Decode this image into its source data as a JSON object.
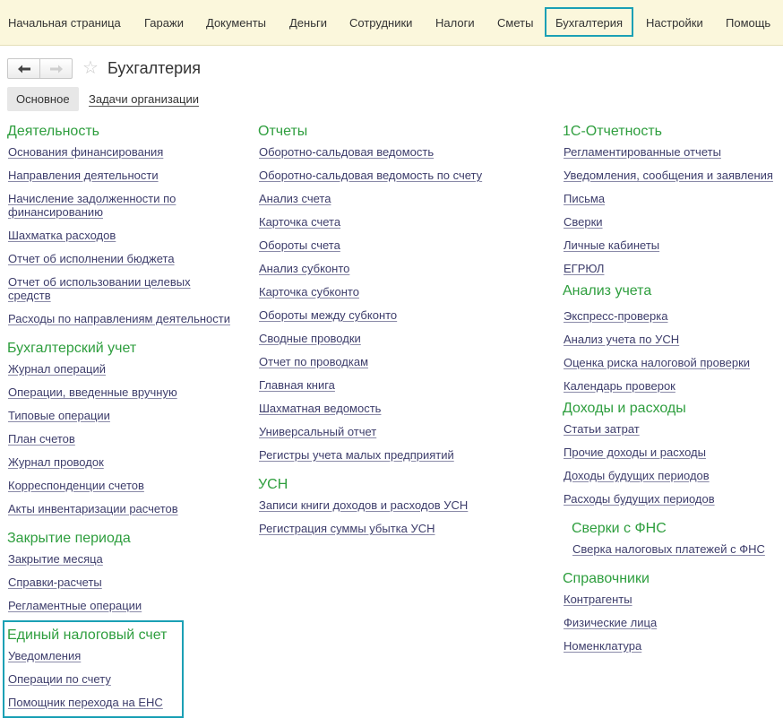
{
  "nav": [
    "Начальная страница",
    "Гаражи",
    "Документы",
    "Деньги",
    "Сотрудники",
    "Налоги",
    "Сметы",
    "Бухгалтерия",
    "Настройки",
    "Помощь"
  ],
  "page": {
    "title": "Бухгалтерия",
    "back_icon": "arrow-left-icon",
    "forward_icon": "arrow-right-icon",
    "favorite_icon": "star-icon"
  },
  "tabs": {
    "main": "Основное",
    "link": "Задачи организации"
  },
  "col1": {
    "s1": {
      "title": "Деятельность",
      "items": [
        "Основания финансирования",
        "Направления деятельности",
        "Начисление задолженности по финансированию",
        "Шахматка расходов",
        "Отчет об исполнении бюджета",
        "Отчет об использовании целевых средств",
        "Расходы по направлениям деятельности"
      ]
    },
    "s2": {
      "title": "Бухгалтерский учет",
      "items": [
        "Журнал операций",
        "Операции, введенные вручную",
        "Типовые операции",
        "План счетов",
        "Журнал проводок",
        "Корреспонденции счетов",
        "Акты инвентаризации расчетов"
      ]
    },
    "s3": {
      "title": "Закрытие периода",
      "items": [
        "Закрытие месяца",
        "Справки-расчеты",
        "Регламентные операции"
      ]
    },
    "s4": {
      "title": "Единый налоговый счет",
      "items": [
        "Уведомления",
        "Операции по счету",
        "Помощник перехода на ЕНС"
      ]
    }
  },
  "col2": {
    "s1": {
      "title": "Отчеты",
      "items": [
        "Оборотно-сальдовая ведомость",
        "Оборотно-сальдовая ведомость по счету",
        "Анализ счета",
        "Карточка счета",
        "Обороты счета",
        "Анализ субконто",
        "Карточка субконто",
        "Обороты между субконто",
        "Сводные проводки",
        "Отчет по проводкам",
        "Главная книга",
        "Шахматная ведомость",
        "Универсальный отчет",
        "Регистры учета малых предприятий"
      ]
    },
    "s2": {
      "title": "УСН",
      "items": [
        "Записи книги доходов и расходов УСН",
        "Регистрация суммы убытка УСН"
      ]
    }
  },
  "col3": {
    "s1": {
      "title": "1С-Отчетность",
      "items": [
        "Регламентированные отчеты",
        "Уведомления, сообщения и заявления",
        "Письма",
        "Сверки",
        "Личные кабинеты",
        "ЕГРЮЛ"
      ]
    },
    "s2": {
      "title": "Анализ учета",
      "items": [
        "Экспресс-проверка",
        "Анализ учета по УСН",
        "Оценка риска налоговой проверки",
        "Календарь проверок"
      ]
    },
    "s3": {
      "title": "Доходы и расходы",
      "items": [
        "Статьи затрат",
        "Прочие доходы и расходы",
        "Доходы будущих периодов",
        "Расходы будущих периодов"
      ]
    },
    "s4": {
      "title": "Сверки с ФНС",
      "items": [
        "Сверка налоговых платежей с ФНС"
      ]
    },
    "s5": {
      "title": "Справочники",
      "items": [
        "Контрагенты",
        "Физические лица",
        "Номенклатура"
      ]
    }
  }
}
